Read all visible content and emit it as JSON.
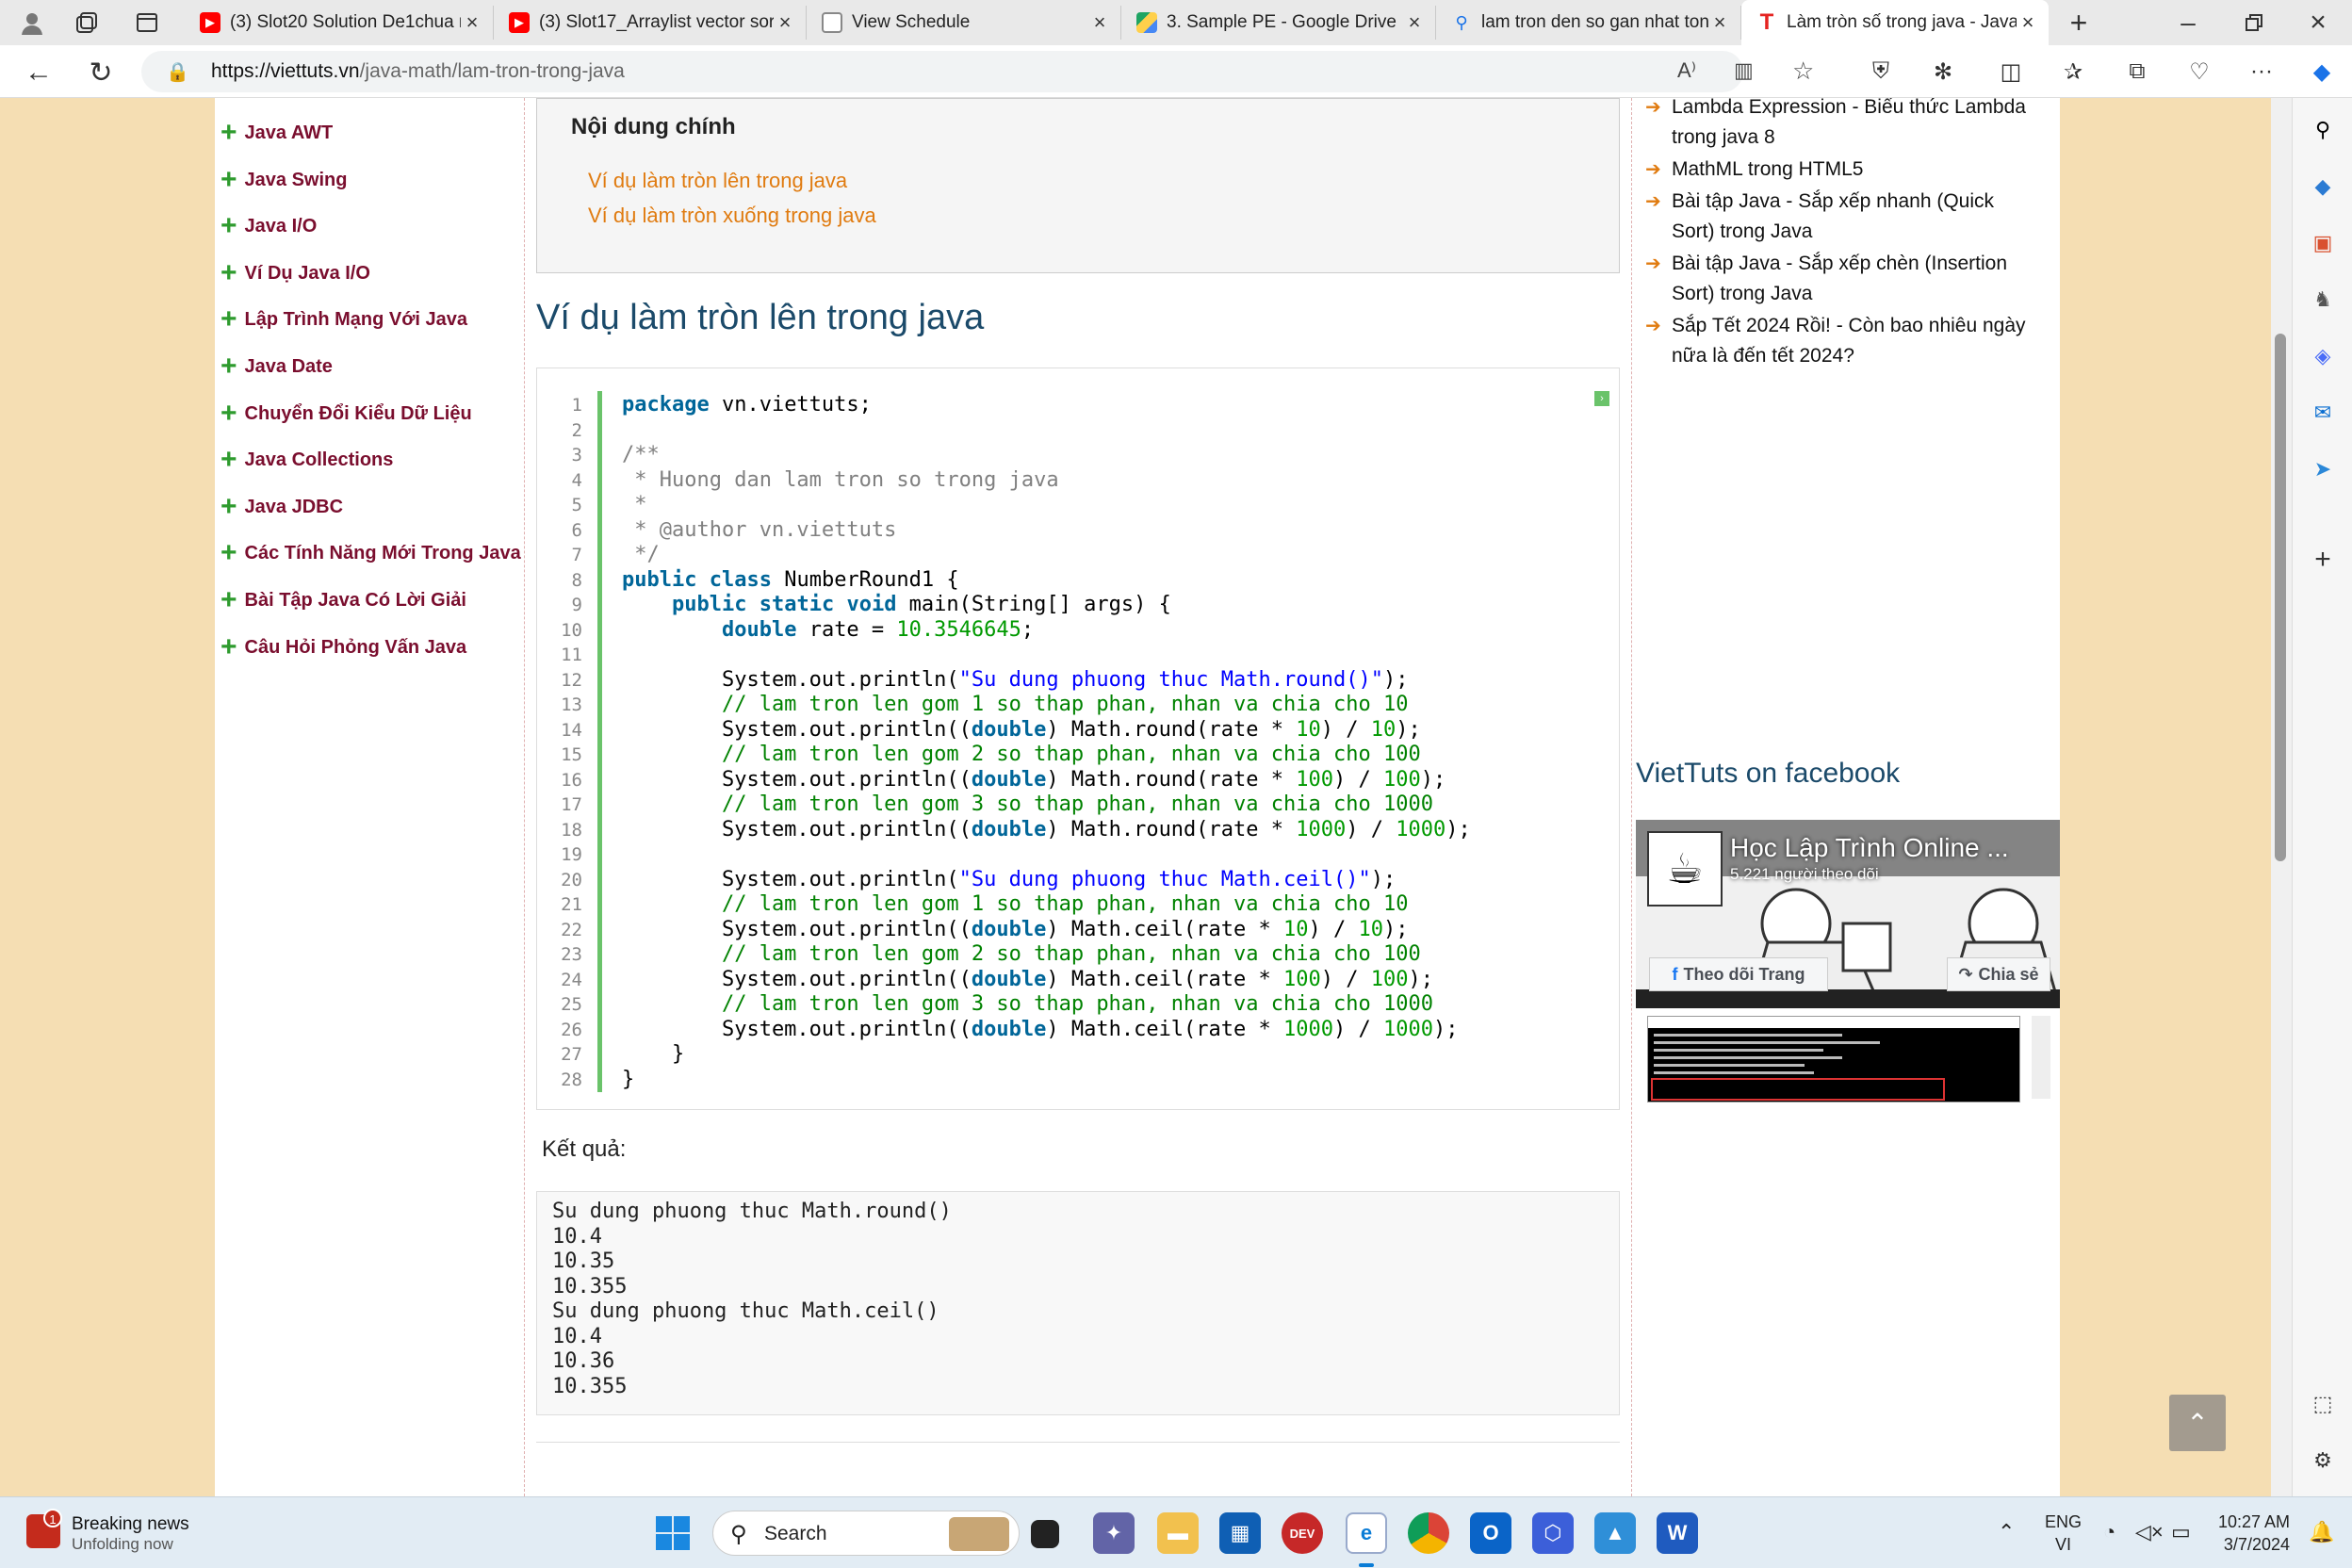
{
  "browser": {
    "tabs": [
      {
        "title": "(3) Slot20 Solution De1chua n",
        "icon": "youtube-icon",
        "color": "#ff0000"
      },
      {
        "title": "(3) Slot17_Arraylist vector sor",
        "icon": "youtube-icon",
        "color": "#ff0000"
      },
      {
        "title": "View Schedule",
        "icon": "document-icon",
        "color": "#888888"
      },
      {
        "title": "3. Sample PE - Google Drive",
        "icon": "google-drive-icon",
        "color": "#1fa463"
      },
      {
        "title": "lam tron den so gan nhat ton",
        "icon": "search-icon",
        "color": "#1a73e8"
      },
      {
        "title": "Làm tròn số trong java - Java",
        "icon": "viettuts-icon",
        "color": "#e52320"
      }
    ],
    "url_domain": "https://viettuts.vn",
    "url_path": "/java-math/lam-tron-trong-java"
  },
  "left_menu": [
    "Java AWT",
    "Java Swing",
    "Java I/O",
    "Ví Dụ Java I/O",
    "Lập Trình Mạng Với Java",
    "Java Date",
    "Chuyển Đổi Kiểu Dữ Liệu",
    "Java Collections",
    "Java JDBC",
    "Các Tính Năng Mới Trong Java",
    "Bài Tập Java Có Lời Giải",
    "Câu Hỏi Phỏng Vấn Java"
  ],
  "toc": {
    "title": "Nội dung chính",
    "links": [
      "Ví dụ làm tròn lên trong java",
      "Ví dụ làm tròn xuống trong java"
    ]
  },
  "section_heading": "Ví dụ làm tròn lên trong java",
  "code_lines": [
    "package vn.viettuts;",
    "",
    "/**",
    " * Huong dan lam tron so trong java",
    " *",
    " * @author vn.viettuts",
    " */",
    "public class NumberRound1 {",
    "    public static void main(String[] args) {",
    "        double rate = 10.3546645;",
    "",
    "        System.out.println(\"Su dung phuong thuc Math.round()\");",
    "        // lam tron len gom 1 so thap phan, nhan va chia cho 10",
    "        System.out.println((double) Math.round(rate * 10) / 10);",
    "        // lam tron len gom 2 so thap phan, nhan va chia cho 100",
    "        System.out.println((double) Math.round(rate * 100) / 100);",
    "        // lam tron len gom 3 so thap phan, nhan va chia cho 1000",
    "        System.out.println((double) Math.round(rate * 1000) / 1000);",
    "",
    "        System.out.println(\"Su dung phuong thuc Math.ceil()\");",
    "        // lam tron len gom 1 so thap phan, nhan va chia cho 10",
    "        System.out.println((double) Math.ceil(rate * 10) / 10);",
    "        // lam tron len gom 2 so thap phan, nhan va chia cho 100",
    "        System.out.println((double) Math.ceil(rate * 100) / 100);",
    "        // lam tron len gom 3 so thap phan, nhan va chia cho 1000",
    "        System.out.println((double) Math.ceil(rate * 1000) / 1000);",
    "    }",
    "}"
  ],
  "result_label": "Kết quả:",
  "result_lines": [
    "Su dung phuong thuc Math.round()",
    "10.4",
    "10.35",
    "10.355",
    "Su dung phuong thuc Math.ceil()",
    "10.4",
    "10.36",
    "10.355"
  ],
  "right_links": [
    {
      "lines": [
        "Lambda Expression - Biểu thức Lambda",
        "trong java 8"
      ]
    },
    {
      "lines": [
        "MathML trong HTML5"
      ]
    },
    {
      "lines": [
        "Bài tập Java - Sắp xếp nhanh (Quick",
        "Sort) trong Java"
      ]
    },
    {
      "lines": [
        "Bài tập Java - Sắp xếp chèn (Insertion",
        "Sort) trong Java"
      ]
    },
    {
      "lines": [
        "Sắp Tết 2024 Rồi! - Còn bao nhiêu ngày",
        "nữa là đến tết 2024?"
      ]
    }
  ],
  "facebook": {
    "title": "VietTuts on facebook",
    "page_name": "Học Lập Trình Online ...",
    "followers": "5.221 người theo dõi",
    "follow_label": "Theo dõi Trang",
    "share_label": "Chia sẻ"
  },
  "taskbar": {
    "news_title": "Breaking news",
    "news_sub": "Unfolding now",
    "news_badge": "1",
    "search_placeholder": "Search",
    "lang_top": "ENG",
    "lang_bottom": "VI",
    "time": "10:27 AM",
    "date": "3/7/2024"
  }
}
